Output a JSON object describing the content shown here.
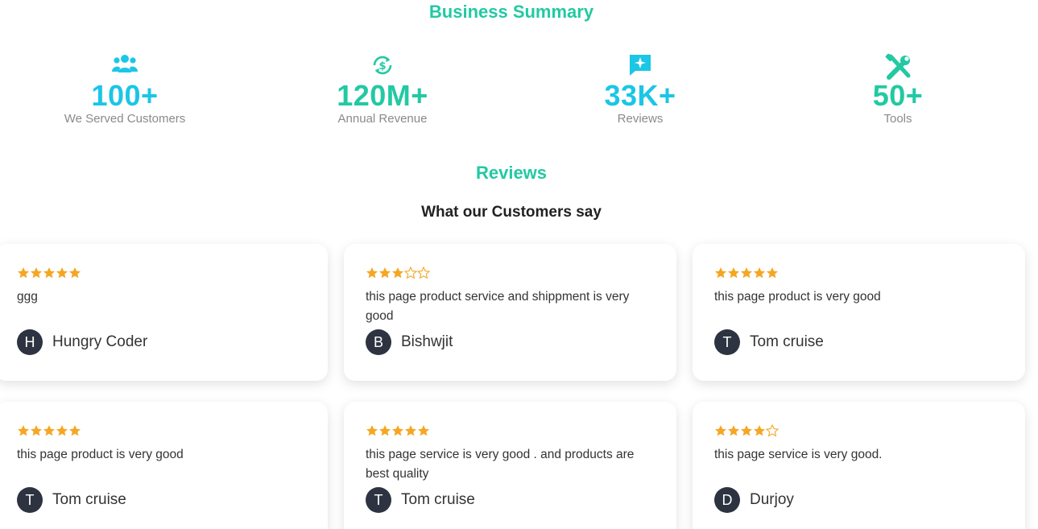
{
  "summary": {
    "title": "Business Summary",
    "stats": [
      {
        "icon": "users-icon",
        "value": "100+",
        "label": "We Served Customers",
        "color": "#1bc6e6"
      },
      {
        "icon": "dollar-cycle-icon",
        "value": "120M+",
        "label": "Annual Revenue",
        "color": "#22c9a3"
      },
      {
        "icon": "chat-sparkle-icon",
        "value": "33K+",
        "label": "Reviews",
        "color": "#1bc6e6"
      },
      {
        "icon": "tools-icon",
        "value": "50+",
        "label": "Tools",
        "color": "#22c9a3"
      }
    ]
  },
  "reviews": {
    "title": "Reviews",
    "subtitle": "What our Customers say",
    "star_color": "#f5a623",
    "items": [
      {
        "rating": 5,
        "text": "ggg",
        "author": "Hungry Coder",
        "initial": "H"
      },
      {
        "rating": 3,
        "text": "this page product service and shippment is very good",
        "author": "Bishwjit",
        "initial": "B"
      },
      {
        "rating": 5,
        "text": "this page product is very good",
        "author": "Tom cruise",
        "initial": "T"
      },
      {
        "rating": 5,
        "text": "this page product is very good",
        "author": "Tom cruise",
        "initial": "T"
      },
      {
        "rating": 5,
        "text": "this page service is very good . and products are best quality",
        "author": "Tom cruise",
        "initial": "T"
      },
      {
        "rating": 4,
        "text": "this page service is very good.",
        "author": "Durjoy",
        "initial": "D"
      }
    ]
  }
}
